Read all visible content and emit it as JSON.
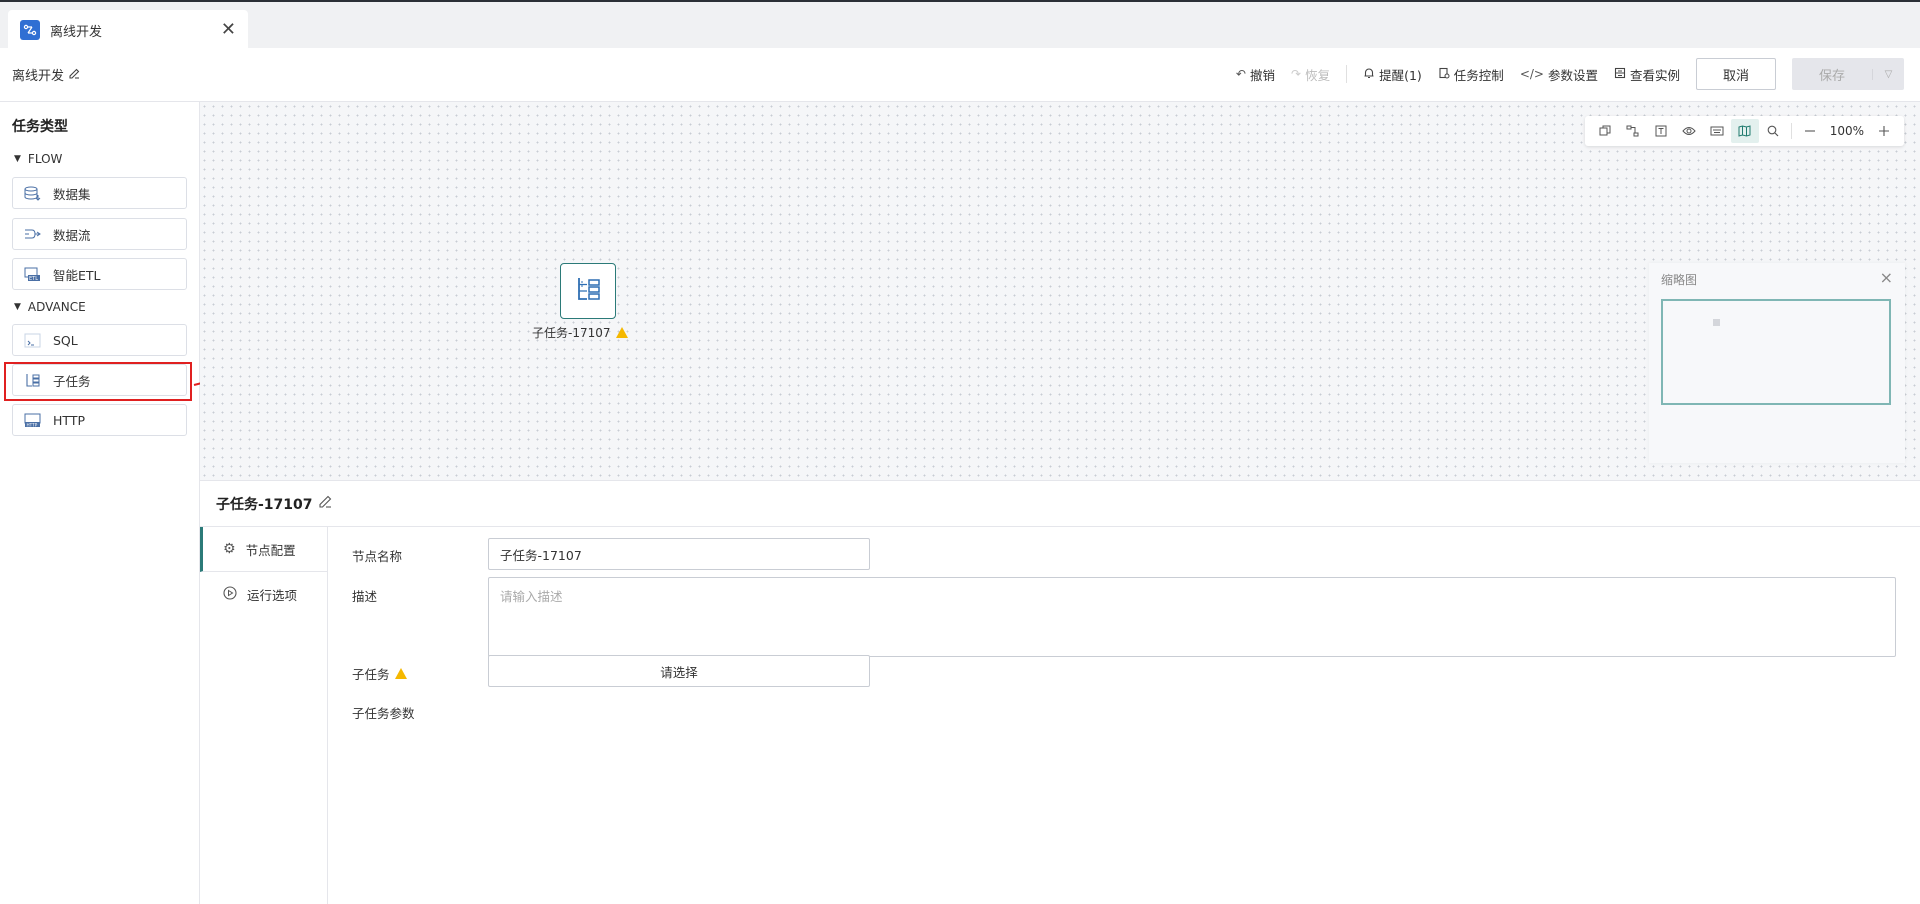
{
  "tab": {
    "title": "离线开发",
    "close": "✕"
  },
  "header": {
    "title": "离线开发"
  },
  "toolbar": {
    "undo": "撤销",
    "redo": "恢复",
    "reminder": "提醒(1)",
    "task_control": "任务控制",
    "param_settings": "参数设置",
    "view_instance": "查看实例",
    "cancel": "取消",
    "save": "保存"
  },
  "sidebar": {
    "title": "任务类型",
    "groups": [
      {
        "name": "FLOW",
        "items": [
          {
            "label": "数据集"
          },
          {
            "label": "数据流"
          },
          {
            "label": "智能ETL"
          }
        ]
      },
      {
        "name": "ADVANCE",
        "items": [
          {
            "label": "SQL"
          },
          {
            "label": "子任务"
          },
          {
            "label": "HTTP"
          }
        ]
      }
    ]
  },
  "canvas": {
    "zoom": "100%",
    "node": {
      "label": "子任务-17107"
    },
    "minimap": {
      "title": "缩略图"
    }
  },
  "panel": {
    "title": "子任务-17107",
    "tabs": [
      {
        "label": "节点配置"
      },
      {
        "label": "运行选项"
      }
    ],
    "form": {
      "node_name_label": "节点名称",
      "node_name_value": "子任务-17107",
      "desc_label": "描述",
      "desc_placeholder": "请输入描述",
      "subtask_label": "子任务",
      "subtask_select": "请选择",
      "subtask_params_label": "子任务参数"
    }
  },
  "colors": {
    "accent": "#2b7a78",
    "annotation": "#e02020",
    "warning": "#f5b800"
  }
}
